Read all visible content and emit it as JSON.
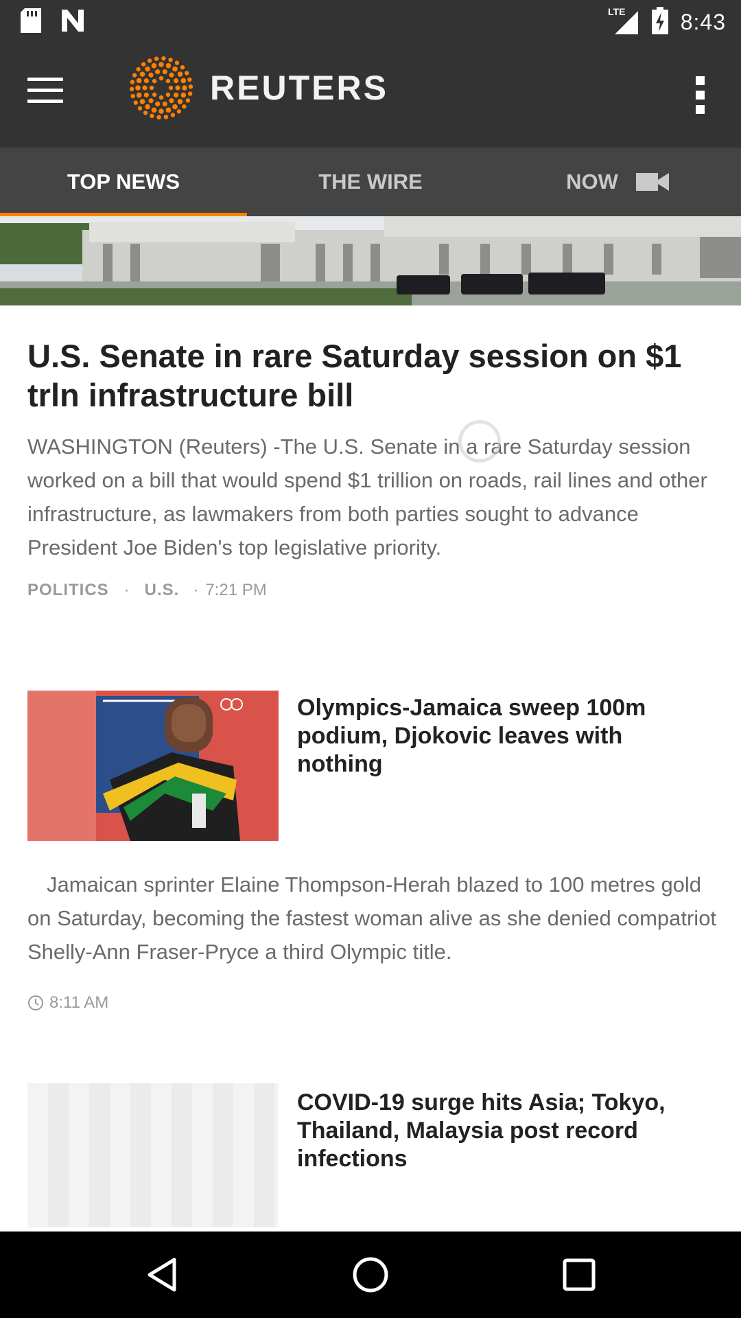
{
  "status_bar": {
    "time": "8:43",
    "network": "LTE",
    "icons": [
      "sd-card-icon",
      "n-notification-icon",
      "signal-icon",
      "battery-charging-icon"
    ]
  },
  "app_bar": {
    "brand": "REUTERS",
    "accent_color": "#ff8000",
    "icons": [
      "hamburger-menu-icon",
      "reuters-logo-icon",
      "overflow-menu-icon"
    ]
  },
  "tabs": [
    {
      "label": "TOP NEWS",
      "active": true
    },
    {
      "label": "THE WIRE",
      "active": false
    },
    {
      "label": "NOW",
      "active": false,
      "icon": "video-camera-icon"
    }
  ],
  "articles": [
    {
      "headline": "U.S. Senate in rare Saturday session on $1 trln infrastructure bill",
      "summary": "WASHINGTON (Reuters) -The U.S. Senate in a rare Saturday session worked on a bill that would spend $1 trillion on roads, rail lines and other infrastructure, as lawmakers from both parties sought to advance President Joe Biden's top legislative priority.",
      "tags": [
        "POLITICS",
        "U.S."
      ],
      "time": "7:21 PM"
    },
    {
      "headline": "Olympics-Jamaica sweep 100m podium, Djokovic leaves with nothing",
      "summary": "Jamaican sprinter Elaine Thompson-Herah blazed to 100 metres gold on Saturday, becoming the fastest woman alive as she denied compatriot Shelly-Ann Fraser-Pryce a third Olympic title.",
      "time": "8:11 AM"
    },
    {
      "headline": "COVID-19 surge hits Asia; Tokyo, Thailand, Malaysia post record infections"
    }
  ]
}
